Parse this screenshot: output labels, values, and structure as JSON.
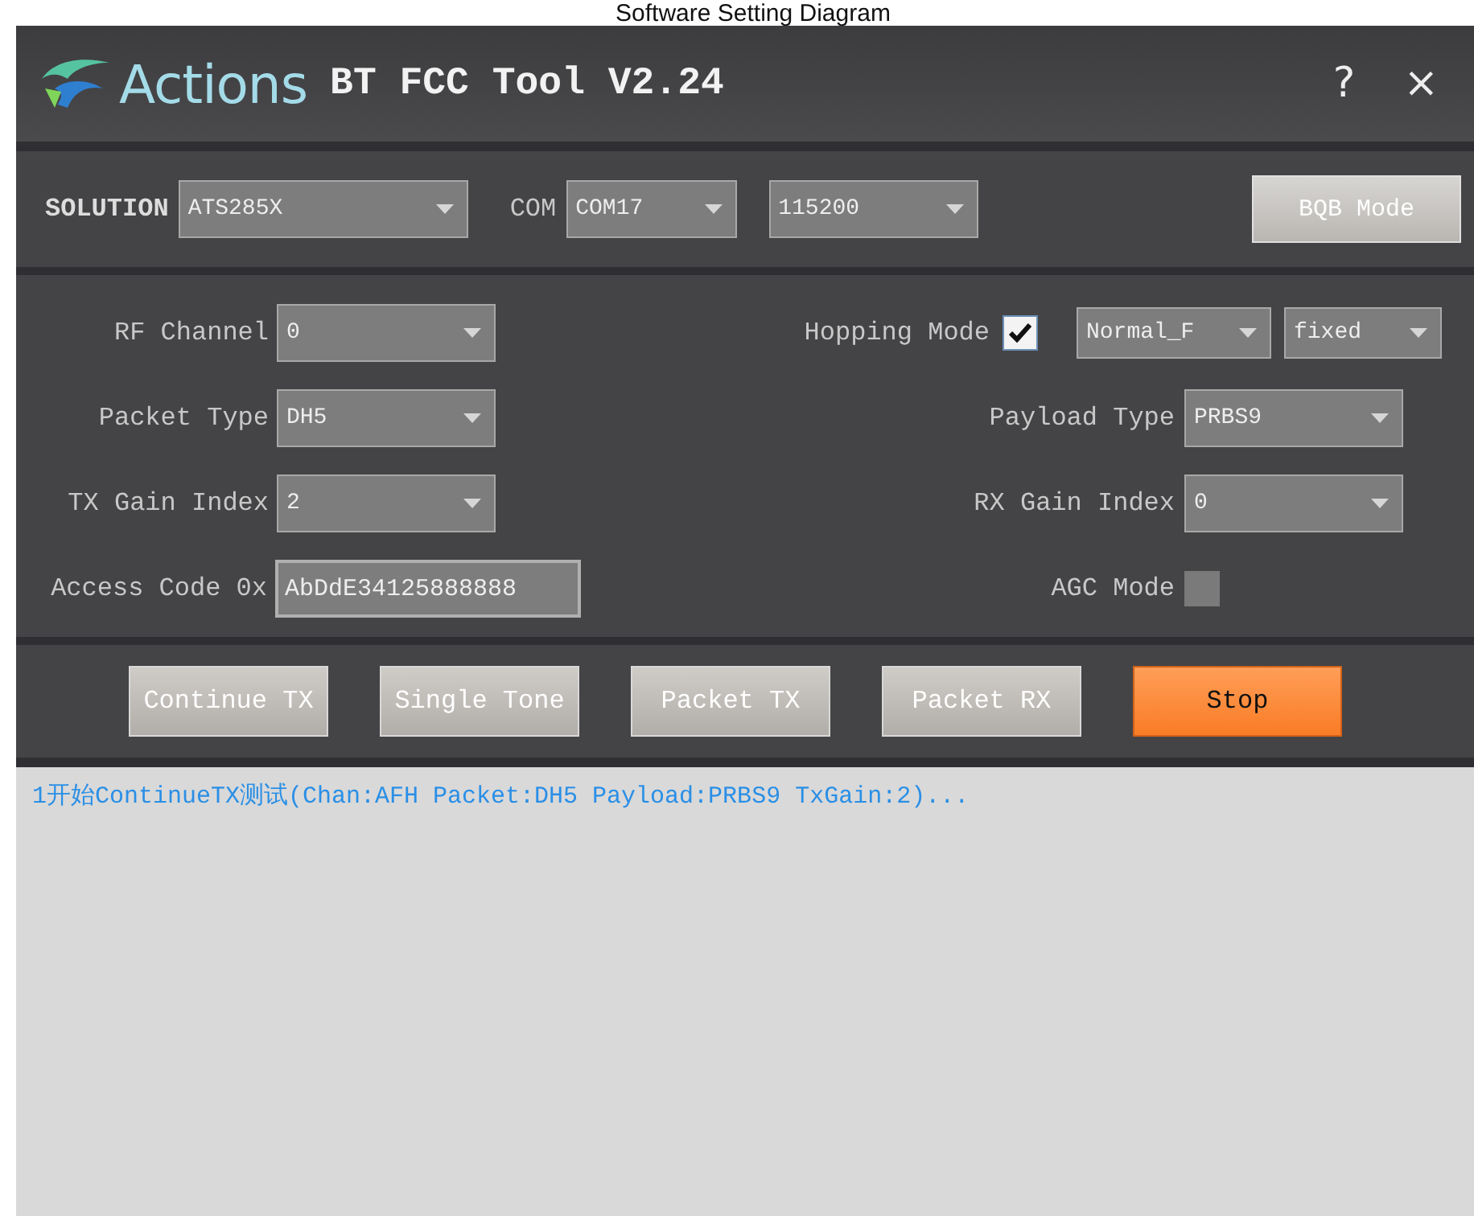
{
  "caption": "Software Setting Diagram",
  "window": {
    "brand": "Actions",
    "title": "BT FCC Tool V2.24",
    "help": "?",
    "close": "×"
  },
  "toolbar": {
    "solution_label": "SOLUTION",
    "solution": "ATS285X",
    "com_label": "COM",
    "com_port": "COM17",
    "baud": "115200",
    "mode_button": "BQB Mode"
  },
  "config_left": [
    {
      "kind": "select",
      "label": "RF Channel",
      "value": "0"
    },
    {
      "kind": "select",
      "label": "Packet Type",
      "value": "DH5"
    },
    {
      "kind": "select",
      "label": "TX Gain Index",
      "value": "2"
    },
    {
      "kind": "text",
      "label": "Access Code 0x",
      "value": "AbDdE34125888888"
    }
  ],
  "config_right": [
    {
      "kind": "hopping",
      "label": "Hopping Mode",
      "checked": true,
      "selects": [
        "Normal_F",
        "fixed"
      ]
    },
    {
      "kind": "select",
      "label": "Payload Type",
      "value": "PRBS9"
    },
    {
      "kind": "select",
      "label": "RX Gain Index",
      "value": "0"
    },
    {
      "kind": "checkbox",
      "label": "AGC Mode",
      "checked": false
    }
  ],
  "actions": [
    {
      "label": "Continue TX",
      "selected": false
    },
    {
      "label": "Single Tone",
      "selected": false
    },
    {
      "label": "Packet TX",
      "selected": false
    },
    {
      "label": "Packet RX",
      "selected": false
    },
    {
      "label": "Stop",
      "selected": true
    }
  ],
  "log": [
    "1开始ContinueTX测试(Chan:AFH Packet:DH5 Payload:PRBS9 TxGain:2)..."
  ]
}
